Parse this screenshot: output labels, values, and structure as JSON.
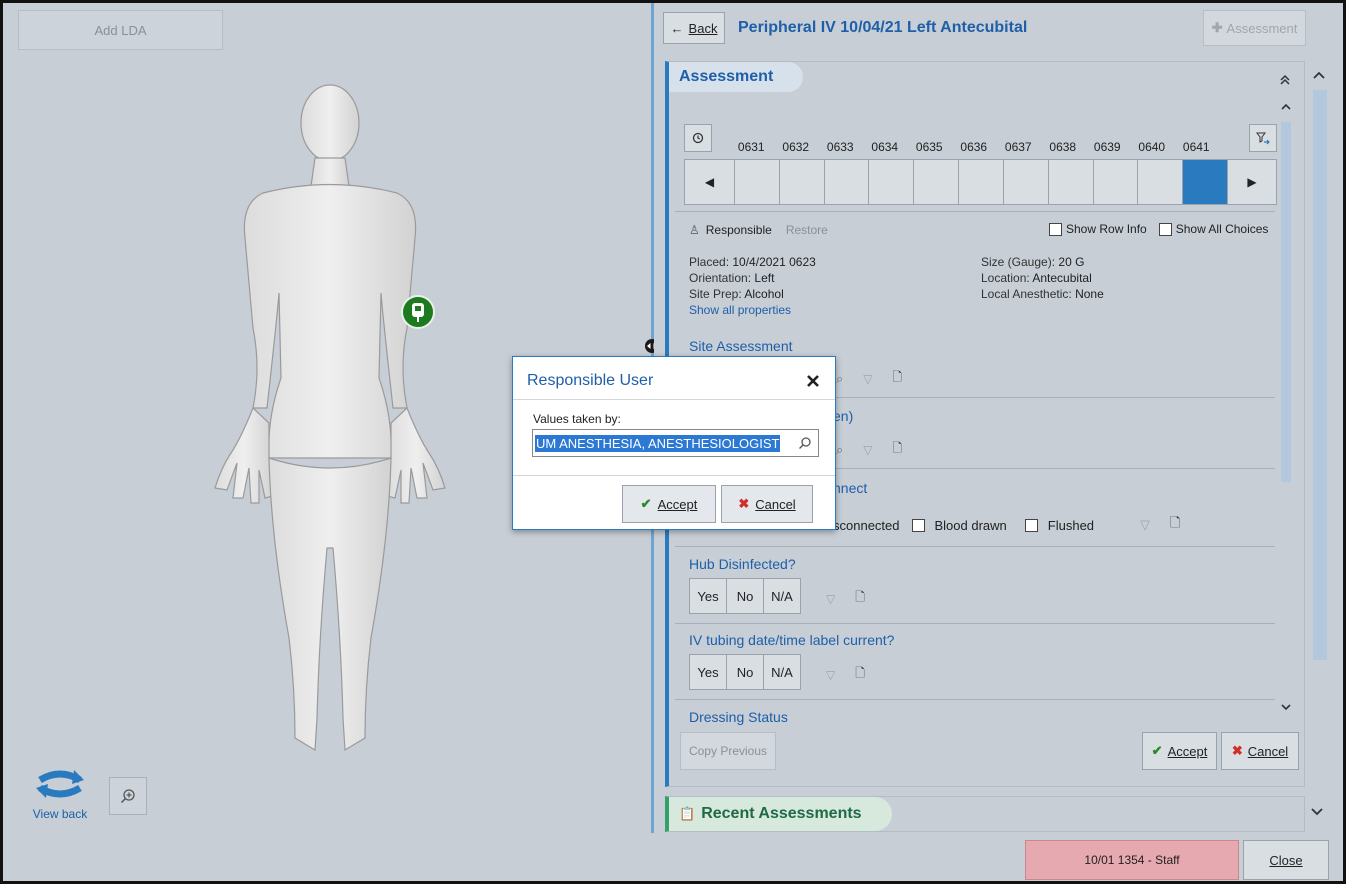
{
  "left": {
    "add_lda_label": "Add LDA",
    "view_back_label": "View back"
  },
  "header": {
    "back_label": "Back",
    "title": "Peripheral IV 10/04/21 Left Antecubital",
    "assessment_btn_label": "Assessment"
  },
  "assessment": {
    "section_title": "Assessment",
    "times": [
      "0631",
      "0632",
      "0633",
      "0634",
      "0635",
      "0636",
      "0637",
      "0638",
      "0639",
      "0640",
      "0641"
    ],
    "selected_time": "0641",
    "responsible_label": "Responsible",
    "restore_label": "Restore",
    "show_row_info_label": "Show Row Info",
    "show_all_choices_label": "Show All Choices",
    "props": {
      "placed_label": "Placed:",
      "placed_value": "10/4/2021  0623",
      "orientation_label": "Orientation:",
      "orientation_value": "Left",
      "site_prep_label": "Site Prep:",
      "site_prep_value": "Alcohol",
      "size_label": "Size (Gauge):",
      "size_value": "20 G",
      "location_label": "Location:",
      "location_value": "Antecubital",
      "local_anesthetic_label": "Local Anesthetic:",
      "local_anesthetic_value": "None",
      "show_all_link": "Show all properties"
    },
    "site_assessment_label": "Site Assessment",
    "row2_partial": "en)",
    "row3_partial": "nnect",
    "row3_opt1": "sconnected",
    "row3_opt2": "Blood drawn",
    "row3_opt3": "Flushed",
    "hub_label": "Hub Disinfected?",
    "iv_label": "IV tubing date/time label current?",
    "yes": "Yes",
    "no": "No",
    "na": "N/A",
    "dressing_label": "Dressing Status",
    "copy_previous_label": "Copy Previous",
    "accept_label": "Accept",
    "cancel_label": "Cancel"
  },
  "recent": {
    "label": "Recent Assessments"
  },
  "footer": {
    "status_text": "10/01 1354 - Staff",
    "close_label": "Close"
  },
  "modal": {
    "title": "Responsible User",
    "field_label": "Values taken by:",
    "field_value": "UM ANESTHESIA, ANESTHESIOLOGIST",
    "accept_label": "Accept",
    "cancel_label": "Cancel"
  },
  "colors": {
    "accent": "#1e5fa8",
    "selected_time": "#2a7ac0",
    "iv_marker": "#1e7a1e",
    "status_bg": "#e7a9b0",
    "recent_accent": "#35a06a"
  }
}
